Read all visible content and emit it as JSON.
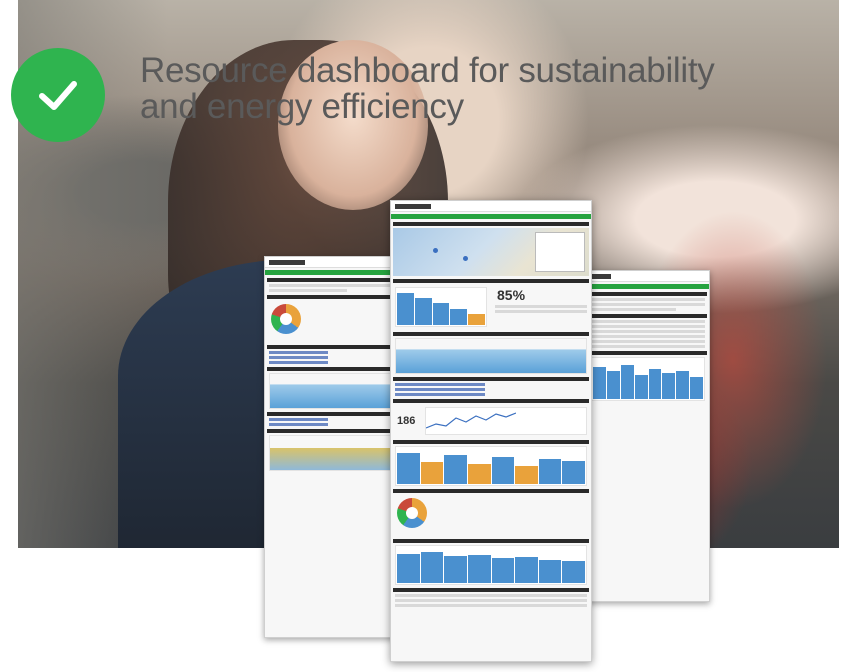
{
  "headline": {
    "line1": "Resource dashboard for sustainability",
    "line2": "and energy efficiency"
  },
  "icons": {
    "check": "check-icon",
    "check_color": "#2fb44f"
  },
  "dashboard_mockups": {
    "score_percent": "85%",
    "meter_value": "186",
    "accent_green": "#26a33f",
    "chart_blue": "#4a90cf",
    "chart_orange": "#e9a23b"
  }
}
